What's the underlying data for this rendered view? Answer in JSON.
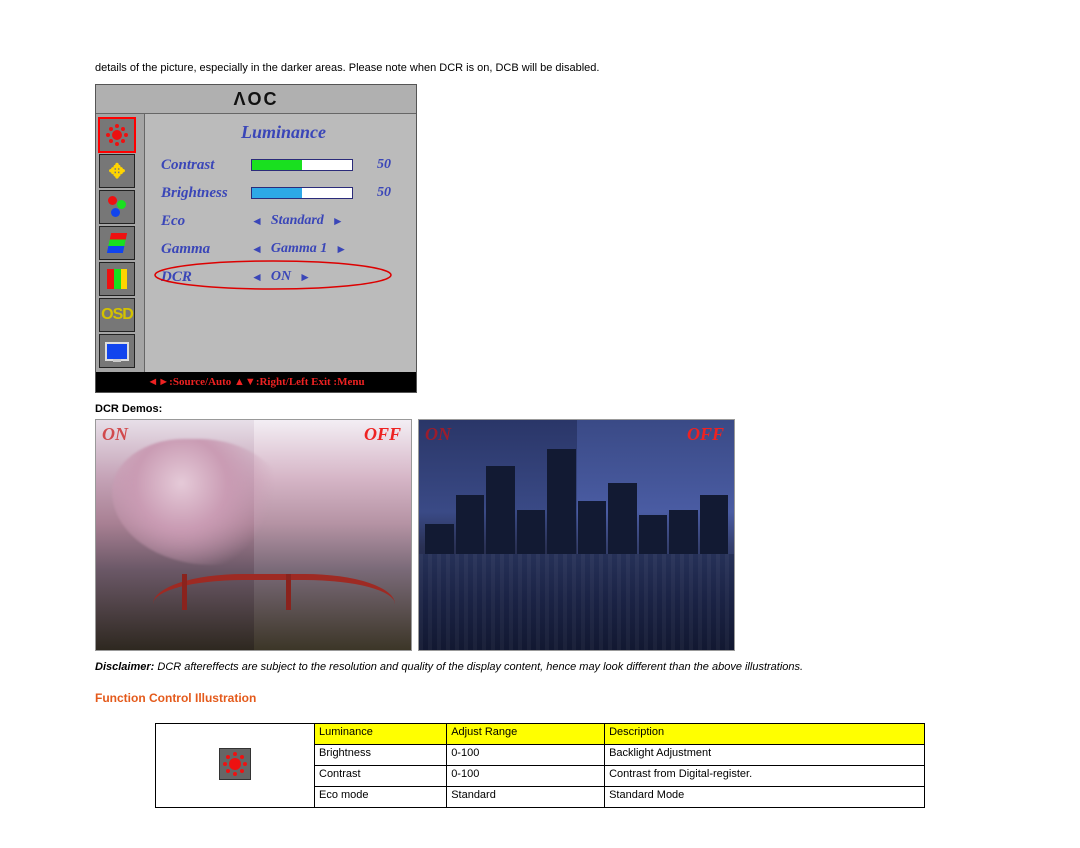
{
  "intro_text": "details of the picture, especially in the darker areas. Please note when DCR is on, DCB will be disabled.",
  "osd": {
    "logo": "ΛOC",
    "title": "Luminance",
    "rows": {
      "contrast": {
        "label": "Contrast",
        "value": "50"
      },
      "brightness": {
        "label": "Brightness",
        "value": "50"
      },
      "eco": {
        "label": "Eco",
        "value": "Standard"
      },
      "gamma": {
        "label": "Gamma",
        "value": "Gamma 1"
      },
      "dcr": {
        "label": "DCR",
        "value": "ON"
      }
    },
    "footer": "◄►:Source/Auto  ▲▼:Right/Left  Exit :Menu"
  },
  "demos_heading": "DCR Demos:",
  "demo_labels": {
    "on": "ON",
    "off": "OFF"
  },
  "disclaimer_label": "Disclaimer:",
  "disclaimer_text": " DCR aftereffects are subject to the resolution and quality of the display content, hence may look different than the above illustrations.",
  "section_heading": "Function Control Illustration",
  "table": {
    "headers": {
      "c1": "Luminance",
      "c2": "Adjust Range",
      "c3": "Description"
    },
    "rows": [
      {
        "c1": "Brightness",
        "c2": "0-100",
        "c3": "Backlight Adjustment"
      },
      {
        "c1": "Contrast",
        "c2": "0-100",
        "c3": "Contrast from Digital-register."
      },
      {
        "c1": "Eco mode",
        "c2": "Standard",
        "c3": "Standard Mode"
      }
    ]
  }
}
